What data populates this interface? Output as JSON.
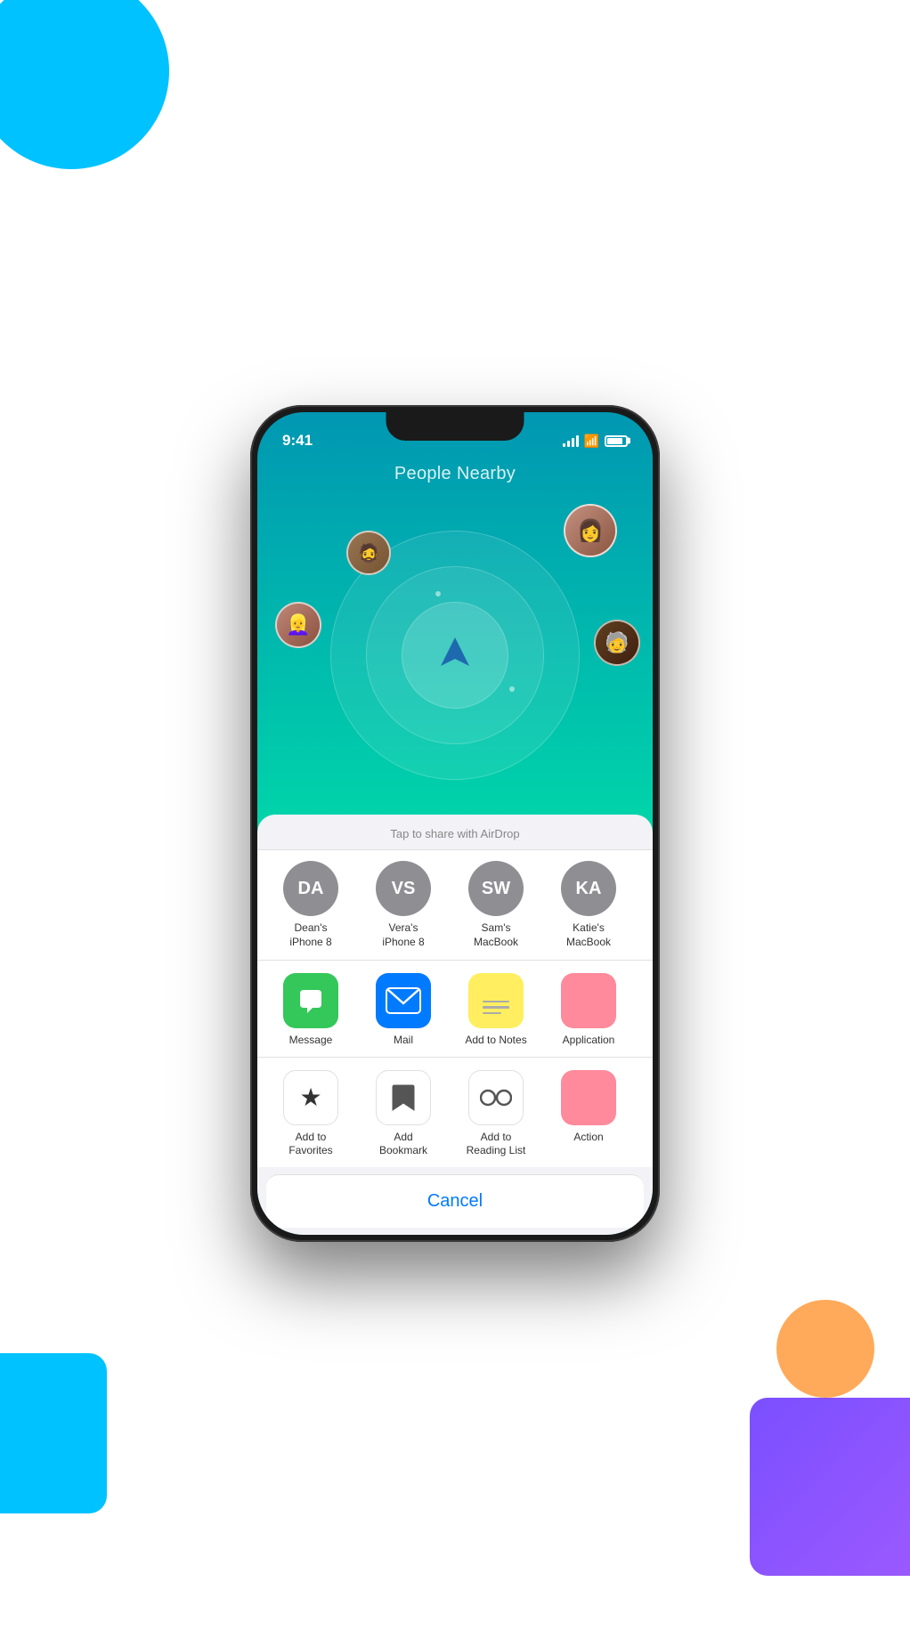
{
  "background": {
    "circle_blue": "#00C2FF",
    "rect_cyan": "#00C2FF",
    "rect_purple": "#7B4FFF",
    "circle_orange": "#FFAA5A"
  },
  "status_bar": {
    "time": "9:41",
    "signal": "signal-icon",
    "wifi": "wifi-icon",
    "battery": "battery-icon"
  },
  "app": {
    "title": "People Nearby"
  },
  "share_sheet": {
    "airdrop_hint": "Tap to share with AirDrop",
    "airdrop_people": [
      {
        "initials": "DA",
        "name": "Dean's\niPhone 8"
      },
      {
        "initials": "VS",
        "name": "Vera's\niPhone 8"
      },
      {
        "initials": "SW",
        "name": "Sam's\nMacBook"
      },
      {
        "initials": "KA",
        "name": "Katie's\nMacBook"
      }
    ],
    "apps": [
      {
        "name": "Message",
        "type": "messages",
        "icon": "💬"
      },
      {
        "name": "Mail",
        "type": "mail",
        "icon": "✉️"
      },
      {
        "name": "Add to Notes",
        "type": "notes",
        "icon": "notes"
      },
      {
        "name": "Application",
        "type": "pink",
        "icon": ""
      }
    ],
    "actions": [
      {
        "name": "Add to\nFavorites",
        "type": "border",
        "icon": "★"
      },
      {
        "name": "Add\nBookmark",
        "type": "border",
        "icon": "📖"
      },
      {
        "name": "Add to\nReading List",
        "type": "border",
        "icon": "👓"
      },
      {
        "name": "Action",
        "type": "pink",
        "icon": ""
      }
    ],
    "cancel_label": "Cancel"
  }
}
